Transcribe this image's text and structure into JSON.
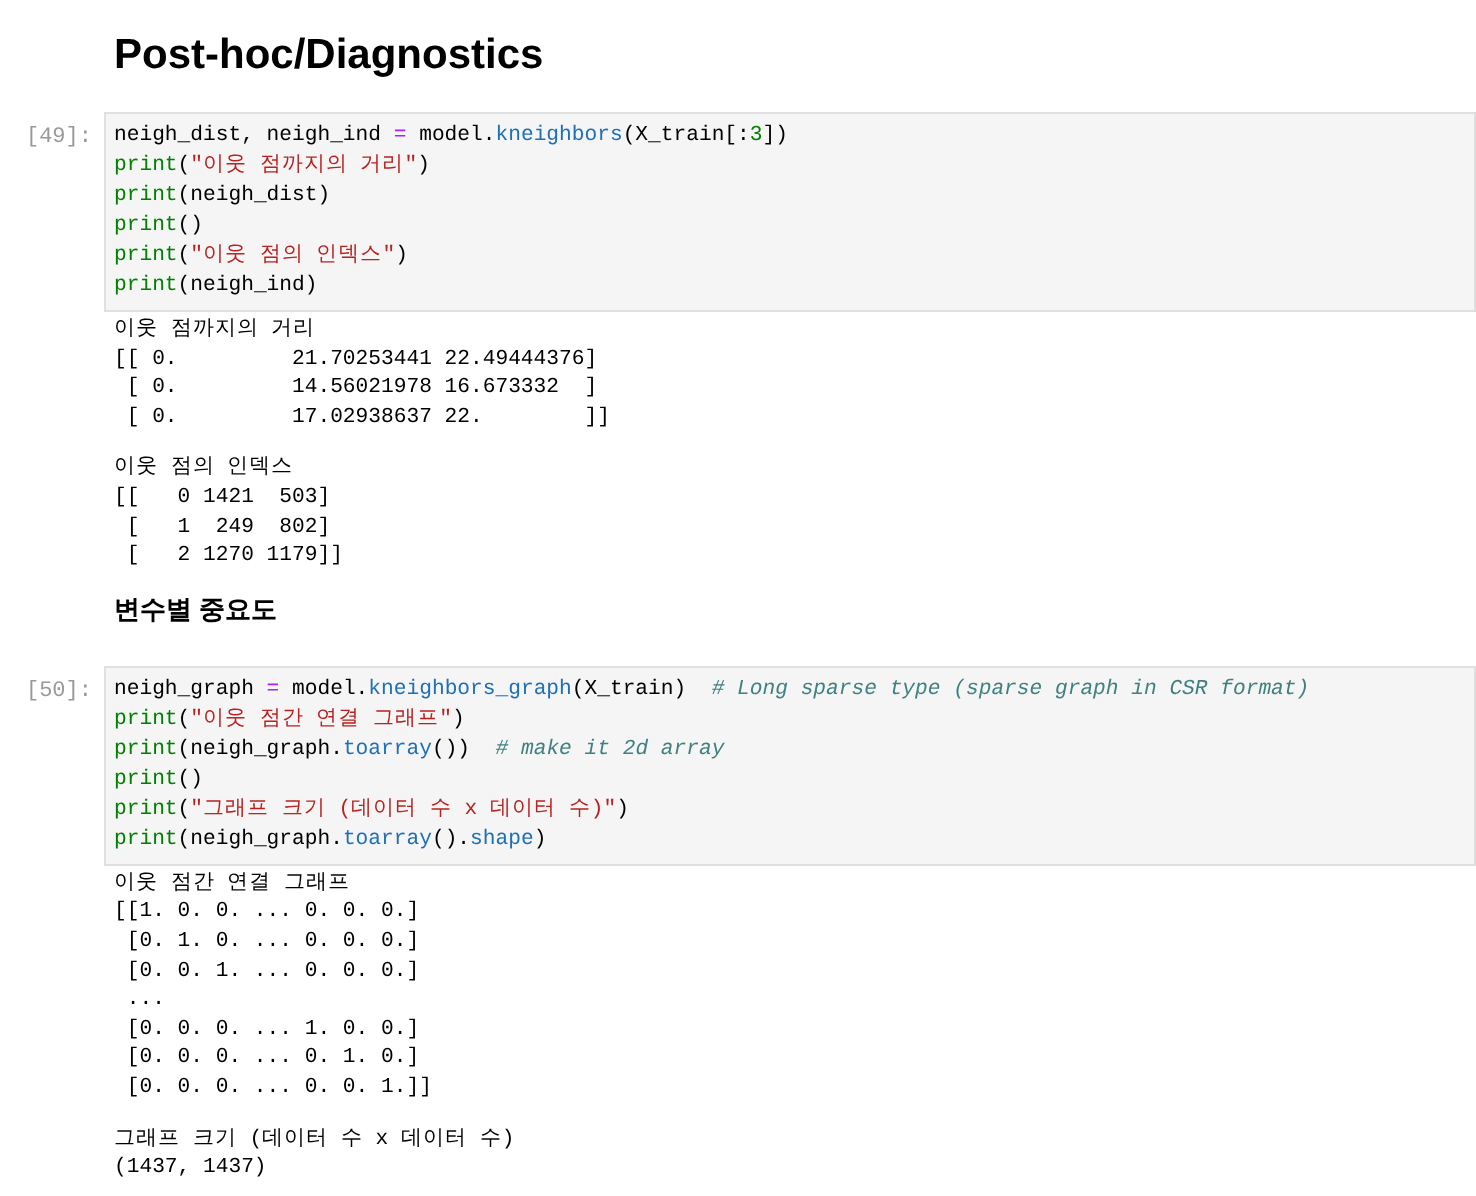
{
  "cells": [
    {
      "kind": "heading",
      "text": "Post-hoc/Diagnostics"
    },
    {
      "kind": "code",
      "prompt": "[49]:",
      "lines": [
        [
          {
            "kind": "text",
            "text": "neigh_dist, neigh_ind "
          },
          {
            "kind": "op",
            "text": "="
          },
          {
            "kind": "text",
            "text": " model."
          },
          {
            "kind": "prop",
            "text": "kneighbors"
          },
          {
            "kind": "text",
            "text": "(X_train[:"
          },
          {
            "kind": "number",
            "text": "3"
          },
          {
            "kind": "text",
            "text": "])"
          }
        ],
        [
          {
            "kind": "builtin",
            "text": "print"
          },
          {
            "kind": "text",
            "text": "("
          },
          {
            "kind": "string",
            "text": "\"이웃 점까지의 거리\""
          },
          {
            "kind": "text",
            "text": ")"
          }
        ],
        [
          {
            "kind": "builtin",
            "text": "print"
          },
          {
            "kind": "text",
            "text": "(neigh_dist)"
          }
        ],
        [
          {
            "kind": "builtin",
            "text": "print"
          },
          {
            "kind": "text",
            "text": "()"
          }
        ],
        [
          {
            "kind": "builtin",
            "text": "print"
          },
          {
            "kind": "text",
            "text": "("
          },
          {
            "kind": "string",
            "text": "\"이웃 점의 인덱스\""
          },
          {
            "kind": "text",
            "text": ")"
          }
        ],
        [
          {
            "kind": "builtin",
            "text": "print"
          },
          {
            "kind": "text",
            "text": "(neigh_ind)"
          }
        ]
      ],
      "output": [
        [
          "이웃 점까지의 거리",
          "[[ 0.         21.70253441 22.49444376]",
          " [ 0.         14.56021978 16.673332  ]",
          " [ 0.         17.02938637 22.        ]]"
        ],
        [
          "이웃 점의 인덱스",
          "[[   0 1421  503]",
          " [   1  249  802]",
          " [   2 1270 1179]]"
        ]
      ]
    },
    {
      "kind": "bold",
      "text": "변수별 중요도"
    },
    {
      "kind": "code",
      "prompt": "[50]:",
      "lines": [
        [
          {
            "kind": "text",
            "text": "neigh_graph "
          },
          {
            "kind": "op",
            "text": "="
          },
          {
            "kind": "text",
            "text": " model."
          },
          {
            "kind": "prop",
            "text": "kneighbors_graph"
          },
          {
            "kind": "text",
            "text": "(X_train)  "
          },
          {
            "kind": "comment",
            "text": "# Long sparse type (sparse graph in CSR format)"
          }
        ],
        [
          {
            "kind": "builtin",
            "text": "print"
          },
          {
            "kind": "text",
            "text": "("
          },
          {
            "kind": "string",
            "text": "\"이웃 점간 연결 그래프\""
          },
          {
            "kind": "text",
            "text": ")"
          }
        ],
        [
          {
            "kind": "builtin",
            "text": "print"
          },
          {
            "kind": "text",
            "text": "(neigh_graph."
          },
          {
            "kind": "prop",
            "text": "toarray"
          },
          {
            "kind": "text",
            "text": "())  "
          },
          {
            "kind": "comment",
            "text": "# make it 2d array"
          }
        ],
        [
          {
            "kind": "builtin",
            "text": "print"
          },
          {
            "kind": "text",
            "text": "()"
          }
        ],
        [
          {
            "kind": "builtin",
            "text": "print"
          },
          {
            "kind": "text",
            "text": "("
          },
          {
            "kind": "string",
            "text": "\"그래프 크기 (데이터 수 x 데이터 수)\""
          },
          {
            "kind": "text",
            "text": ")"
          }
        ],
        [
          {
            "kind": "builtin",
            "text": "print"
          },
          {
            "kind": "text",
            "text": "(neigh_graph."
          },
          {
            "kind": "prop",
            "text": "toarray"
          },
          {
            "kind": "text",
            "text": "()."
          },
          {
            "kind": "prop",
            "text": "shape"
          },
          {
            "kind": "text",
            "text": ")"
          }
        ]
      ],
      "output": [
        [
          "이웃 점간 연결 그래프",
          "[[1. 0. 0. ... 0. 0. 0.]",
          " [0. 1. 0. ... 0. 0. 0.]",
          " [0. 0. 1. ... 0. 0. 0.]",
          " ...",
          " [0. 0. 0. ... 1. 0. 0.]",
          " [0. 0. 0. ... 0. 1. 0.]",
          " [0. 0. 0. ... 0. 0. 1.]]"
        ],
        [
          "그래프 크기 (데이터 수 x 데이터 수)",
          "(1437, 1437)"
        ]
      ]
    }
  ]
}
